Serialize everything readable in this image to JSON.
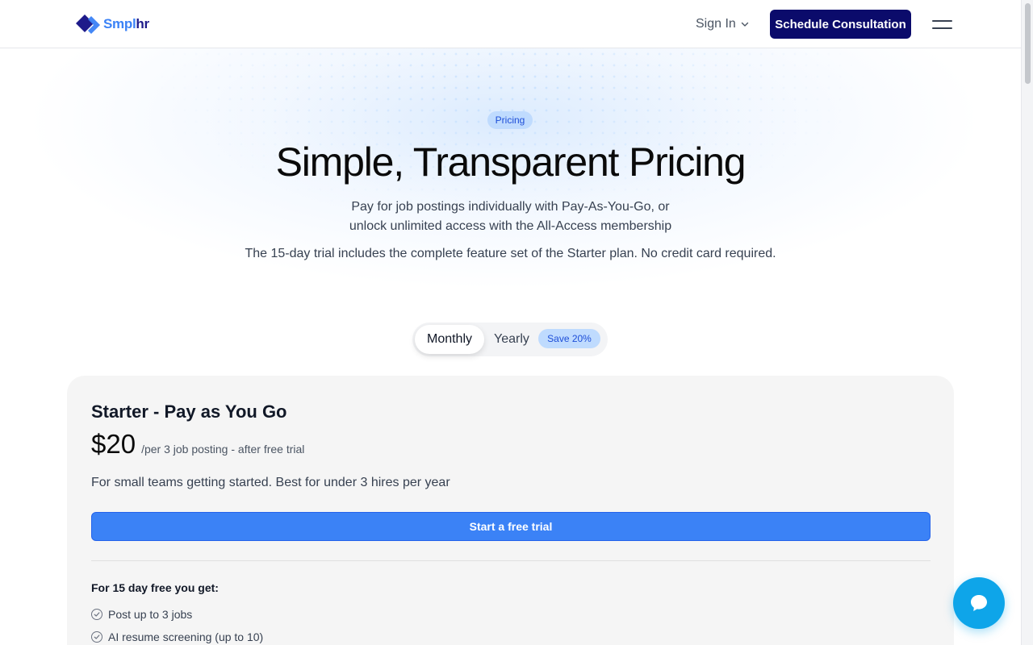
{
  "header": {
    "logo_part1": "Smpl",
    "logo_part2": "hr",
    "sign_in_label": "Sign In",
    "consult_label": "Schedule Consultation"
  },
  "hero": {
    "pill_label": "Pricing",
    "title": "Simple, Transparent Pricing",
    "subtitle_line1": "Pay for job postings individually with Pay-As-You-Go, or",
    "subtitle_line2": "unlock unlimited access with the All-Access membership",
    "trial_note": "The 15-day trial includes the complete feature set of the Starter plan. No credit card required."
  },
  "billing_toggle": {
    "monthly_label": "Monthly",
    "yearly_label": "Yearly",
    "save_badge": "Save 20%",
    "selected": "Monthly"
  },
  "plan": {
    "name": "Starter - Pay as You Go",
    "price": "$20",
    "price_unit": "/per 3 job posting - after free trial",
    "description": "For small teams getting started. Best for under 3 hires per year",
    "cta_label": "Start a free trial",
    "features_title": "For 15 day free you get:",
    "features": [
      "Post up to 3 jobs",
      "AI resume screening (up to 10)"
    ]
  },
  "colors": {
    "brand_navy": "#0b0b6b",
    "brand_blue": "#3b82f6",
    "chat_blue": "#0ea5e9",
    "badge_bg": "#bfdbfe"
  },
  "icons": {
    "sign_in_caret": "chevron-down-icon",
    "menu": "hamburger-icon",
    "feature_bullet": "check-circle-icon",
    "chat": "chat-bubble-icon"
  }
}
